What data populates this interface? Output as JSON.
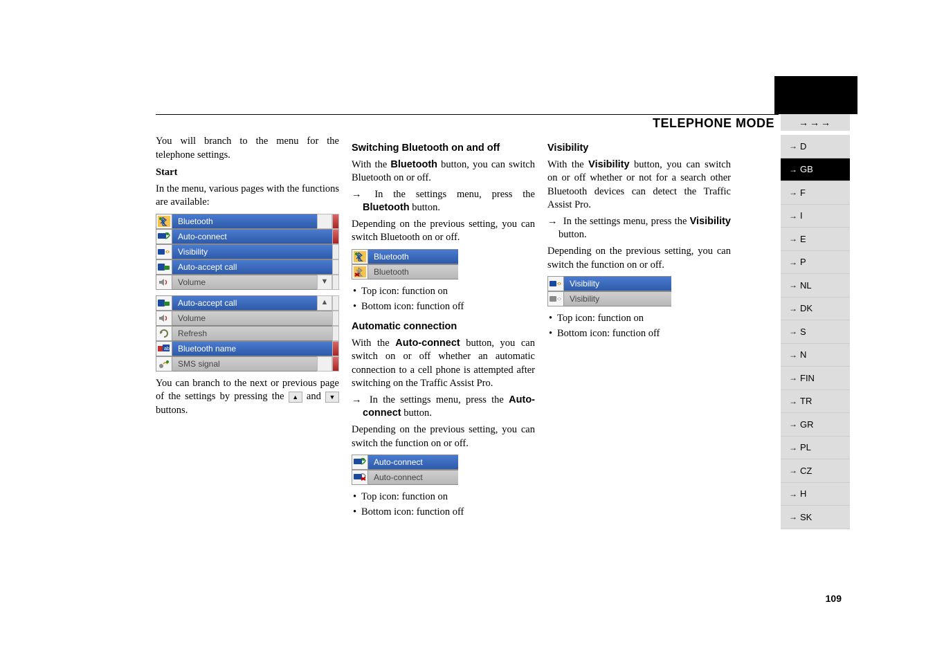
{
  "header": {
    "mode_title": "TELEPHONE MODE",
    "arrows": "→→→"
  },
  "page_number": "109",
  "side_tabs": {
    "items": [
      "D",
      "GB",
      "F",
      "I",
      "E",
      "P",
      "NL",
      "DK",
      "S",
      "N",
      "FIN",
      "TR",
      "GR",
      "PL",
      "CZ",
      "H",
      "SK"
    ],
    "selected_index": 1
  },
  "col1": {
    "intro": "You will branch to the menu for the telephone settings.",
    "start_heading": "Start",
    "start_text": "In the menu, various pages with the functions are available:",
    "menu_page1": [
      {
        "label": "Bluetooth",
        "style": "blue",
        "icon": "bt-on"
      },
      {
        "label": "Auto-connect",
        "style": "blue",
        "icon": "auto-on"
      },
      {
        "label": "Visibility",
        "style": "blue",
        "icon": "vis-on"
      },
      {
        "label": "Auto-accept call",
        "style": "blue",
        "icon": "accept"
      },
      {
        "label": "Volume",
        "style": "grey",
        "icon": "volume"
      }
    ],
    "menu_page2": [
      {
        "label": "Auto-accept call",
        "style": "blue",
        "icon": "accept"
      },
      {
        "label": "Volume",
        "style": "grey",
        "icon": "volume"
      },
      {
        "label": "Refresh",
        "style": "grey",
        "icon": "refresh"
      },
      {
        "label": "Bluetooth name",
        "style": "blue",
        "icon": "btname"
      },
      {
        "label": "SMS signal",
        "style": "grey",
        "icon": "sms"
      }
    ],
    "nav_text_a": "You can branch to the next or previous page of the settings by pressing the ",
    "nav_text_b": " and ",
    "nav_text_c": " buttons."
  },
  "col2": {
    "h_switch": "Switching Bluetooth on and off",
    "switch_p1a": "With the ",
    "switch_p1b": "Bluetooth",
    "switch_p1c": " button, you can switch Bluetooth on or off.",
    "switch_step_a": "In the settings menu, press the ",
    "switch_step_b": "Bluetooth",
    "switch_step_c": " button.",
    "switch_p2": "Depending on the previous setting, you can switch Bluetooth on or off.",
    "bt_rows": [
      {
        "label": "Bluetooth",
        "style": "blue",
        "icon": "bt-on"
      },
      {
        "label": "Bluetooth",
        "style": "grey",
        "icon": "bt-off"
      }
    ],
    "bullets_top": "Top icon: function on",
    "bullets_bot": "Bottom icon: function off",
    "h_auto": "Automatic connection",
    "auto_p1a": "With the ",
    "auto_p1b": "Auto-connect",
    "auto_p1c": " button, you can switch on or off whether an automatic connection to a cell phone is attempted after switching on the Traffic Assist Pro.",
    "auto_step_a": "In the settings menu, press the ",
    "auto_step_b": "Auto-connect",
    "auto_step_c": " button.",
    "auto_p2": "Depending on the previous setting, you can switch the function on or off.",
    "auto_rows": [
      {
        "label": "Auto-connect",
        "style": "blue",
        "icon": "auto-on"
      },
      {
        "label": "Auto-connect",
        "style": "grey",
        "icon": "auto-off"
      }
    ]
  },
  "col3": {
    "h_vis": "Visibility",
    "vis_p1a": "With the ",
    "vis_p1b": "Visibility",
    "vis_p1c": " button, you can switch on or off whether or not for a search other Bluetooth devices can detect the Traffic Assist Pro.",
    "vis_step_a": "In the settings menu, press the ",
    "vis_step_b": "Visibility",
    "vis_step_c": " button.",
    "vis_p2": "Depending on the previous setting, you can switch the function on or off.",
    "vis_rows": [
      {
        "label": "Visibility",
        "style": "blue",
        "icon": "vis-on"
      },
      {
        "label": "Visibility",
        "style": "grey",
        "icon": "vis-off"
      }
    ],
    "bullets_top": "Top icon: function on",
    "bullets_bot": "Bottom icon: function off"
  }
}
